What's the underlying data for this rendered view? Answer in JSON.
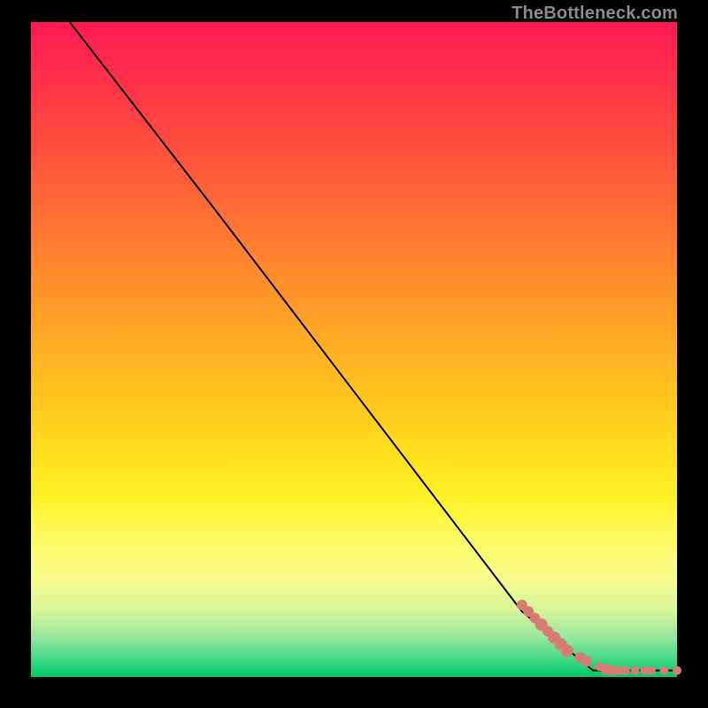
{
  "watermark": "TheBottleneck.com",
  "colors": {
    "dot": "#d77c72",
    "curve": "#000000",
    "frame": "#000000"
  },
  "chart_data": {
    "type": "line",
    "title": "",
    "xlabel": "",
    "ylabel": "",
    "xlim": [
      0,
      100
    ],
    "ylim": [
      0,
      100
    ],
    "grid": false,
    "legend": false,
    "series": [
      {
        "name": "curve",
        "x": [
          6,
          28,
          76,
          87,
          100
        ],
        "y": [
          100,
          72,
          10,
          1,
          1
        ]
      }
    ],
    "scatter": {
      "name": "points",
      "x": [
        76,
        77,
        78,
        79,
        80,
        81,
        82,
        83,
        85,
        86,
        88,
        89,
        90,
        91,
        92,
        93.5,
        95,
        96,
        98,
        100
      ],
      "y": [
        11,
        10,
        9,
        8,
        7,
        6,
        5,
        4,
        3,
        2.4,
        1.6,
        1.2,
        1.0,
        1.0,
        1.0,
        1.0,
        1.0,
        1.0,
        1.0,
        1.0
      ],
      "r": [
        6,
        6,
        6,
        7,
        6,
        7,
        7,
        7,
        6,
        6,
        5,
        6,
        6,
        5,
        5,
        5,
        5,
        5,
        5,
        5
      ]
    }
  }
}
